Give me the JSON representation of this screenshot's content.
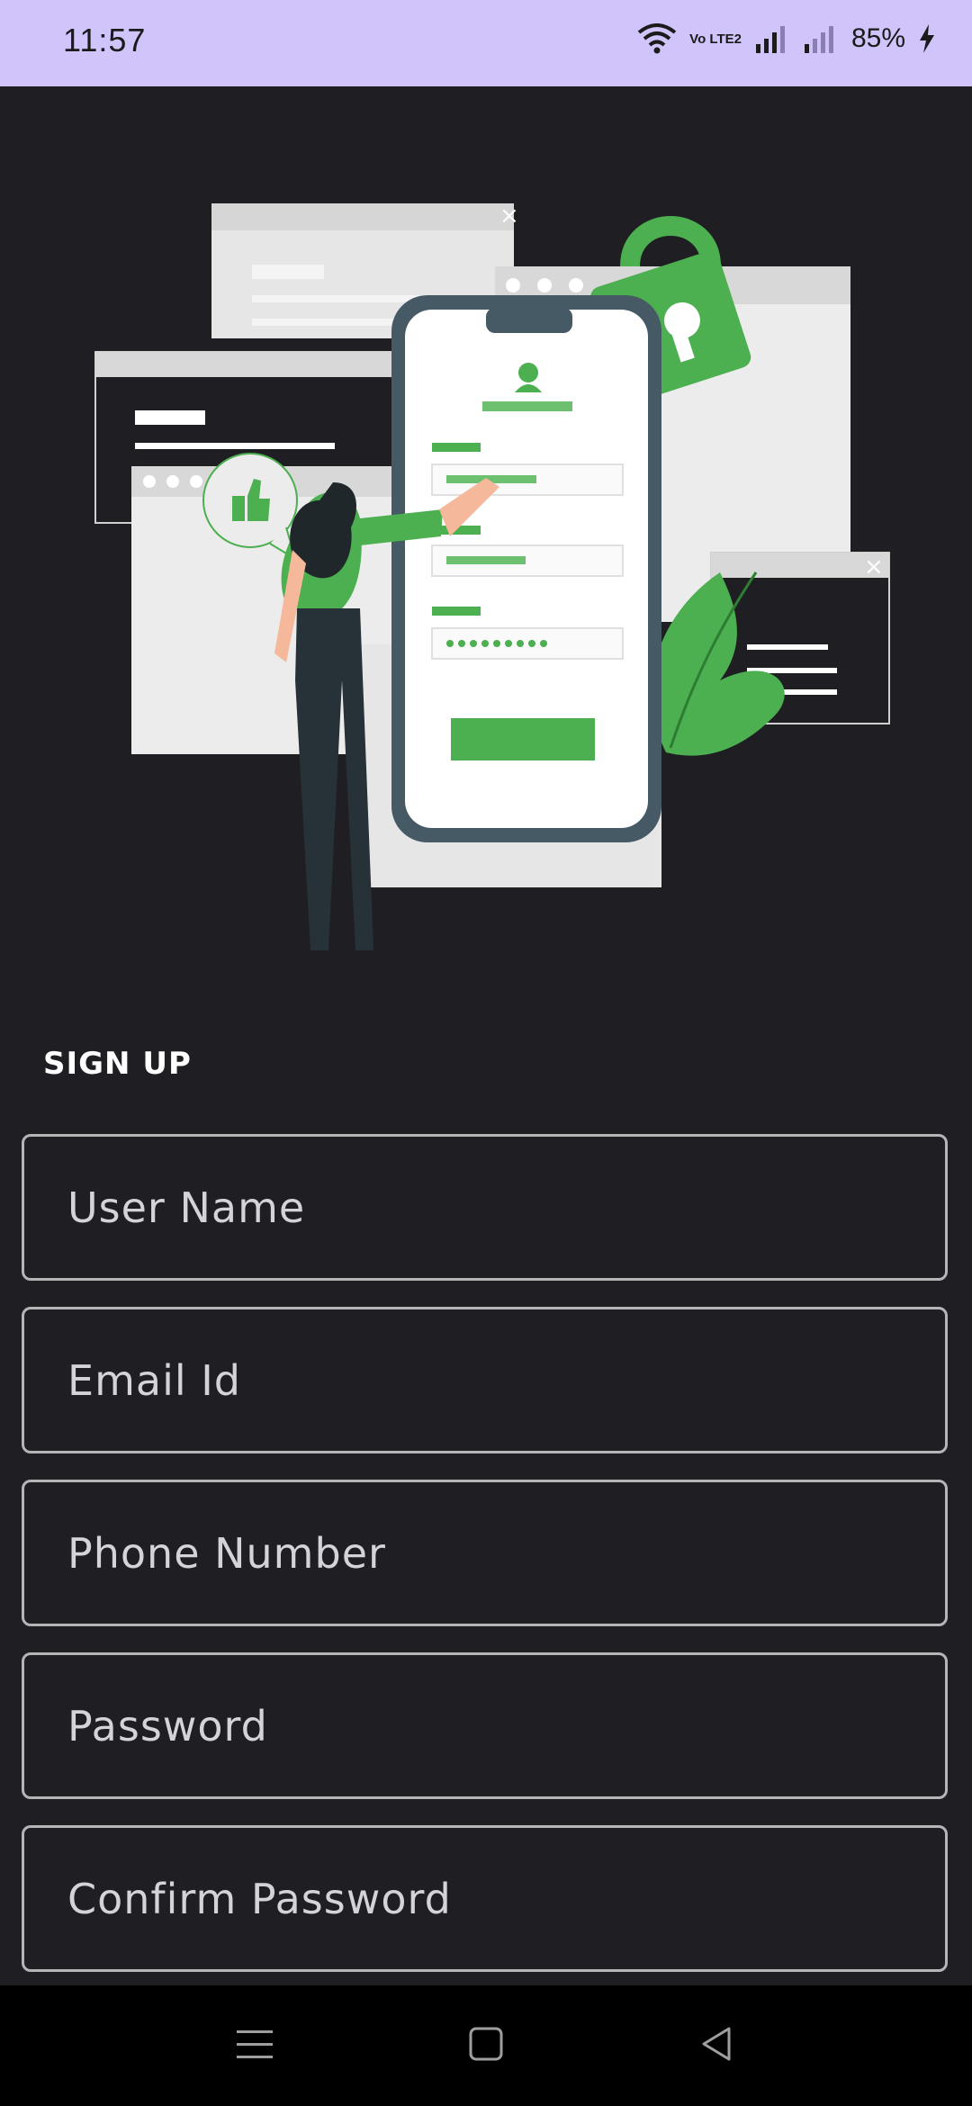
{
  "status_bar": {
    "time": "11:57",
    "volte": "Vo LTE2",
    "battery": "85%"
  },
  "form": {
    "heading": "SIGN UP",
    "fields": [
      {
        "placeholder": "User Name"
      },
      {
        "placeholder": "Email Id"
      },
      {
        "placeholder": "Phone Number"
      },
      {
        "placeholder": "Password"
      },
      {
        "placeholder": "Confirm Password"
      }
    ]
  },
  "colors": {
    "status_bar_bg": "#d1c4fb",
    "app_bg": "#1f1f23",
    "accent_green": "#4caf50",
    "field_border": "#b5b5b8",
    "nav_bar_bg": "#000000"
  },
  "icons": {
    "status": [
      "wifi-icon",
      "volte-icon",
      "signal-icon",
      "signal-icon",
      "battery-charging-icon"
    ],
    "nav": [
      "menu-icon",
      "home-icon",
      "back-icon"
    ]
  }
}
